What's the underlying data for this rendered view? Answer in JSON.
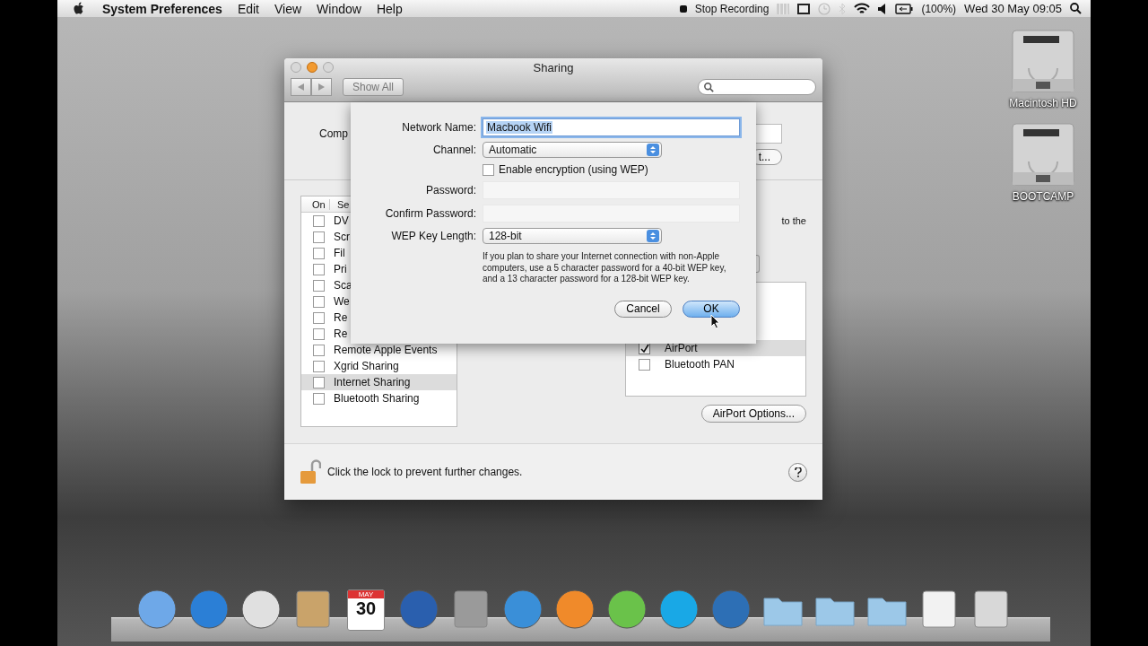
{
  "menubar": {
    "menus": [
      {
        "label": "System Preferences",
        "kind": "app"
      },
      {
        "label": "Edit",
        "kind": "menu"
      },
      {
        "label": "View",
        "kind": "menu"
      },
      {
        "label": "Window",
        "kind": "menu"
      },
      {
        "label": "Help",
        "kind": "menu"
      }
    ],
    "recording": "Stop Recording",
    "battery": "(100%)",
    "clock": "Wed 30 May  09:05"
  },
  "desktop_icons": [
    {
      "label": "Macintosh HD"
    },
    {
      "label": "BOOTCAMP"
    }
  ],
  "window": {
    "title": "Sharing",
    "show_all": "Show All"
  },
  "computer_name_label": "Comp",
  "edit_button": "t...",
  "description_fragment": "to the",
  "services": {
    "columns": [
      "On",
      "Se"
    ],
    "rows": [
      {
        "name": "DV",
        "checked": false,
        "selected": false
      },
      {
        "name": "Scr",
        "checked": false,
        "selected": false
      },
      {
        "name": "Fil",
        "checked": false,
        "selected": false
      },
      {
        "name": "Pri",
        "checked": false,
        "selected": false
      },
      {
        "name": "Sca",
        "checked": false,
        "selected": false
      },
      {
        "name": "We",
        "checked": false,
        "selected": false
      },
      {
        "name": "Re",
        "checked": false,
        "selected": false
      },
      {
        "name": "Re",
        "checked": false,
        "selected": false
      },
      {
        "name": "Remote Apple Events",
        "checked": false,
        "selected": false
      },
      {
        "name": "Xgrid Sharing",
        "checked": false,
        "selected": false
      },
      {
        "name": "Internet Sharing",
        "checked": false,
        "selected": true
      },
      {
        "name": "Bluetooth Sharing",
        "checked": false,
        "selected": false
      }
    ]
  },
  "interfaces": [
    {
      "name": "AirPort",
      "checked": true,
      "selected": true
    },
    {
      "name": "Bluetooth PAN",
      "checked": false,
      "selected": false
    }
  ],
  "airport_options": "AirPort Options...",
  "lock": {
    "text": "Click the lock to prevent further changes.",
    "locked": false
  },
  "sheet": {
    "network_name": {
      "label": "Network Name:",
      "value": "Macbook Wifi"
    },
    "channel": {
      "label": "Channel:",
      "value": "Automatic"
    },
    "encryption": {
      "label": "Enable encryption (using WEP)",
      "checked": false
    },
    "password": {
      "label": "Password:"
    },
    "confirm_password": {
      "label": "Confirm Password:"
    },
    "wep_key_length": {
      "label": "WEP Key Length:",
      "value": "128-bit"
    },
    "note": "If you plan to share your Internet connection with non-Apple computers, use a 5 character password for a 40-bit WEP key, and a 13 character password for a 128-bit WEP key.",
    "buttons": [
      {
        "label": "Cancel",
        "default": false
      },
      {
        "label": "OK",
        "default": true
      }
    ]
  },
  "dock": {
    "calendar_month": "MAY",
    "calendar_day": "30"
  }
}
